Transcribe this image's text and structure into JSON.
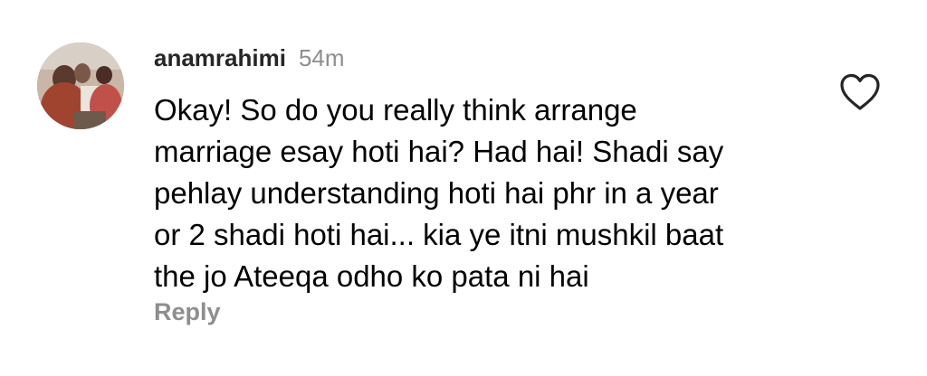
{
  "comment": {
    "username": "anamrahimi",
    "timestamp": "54m",
    "text_lines": [
      "Okay! So do you really think arrange",
      "marriage esay hoti hai? Had hai! Shadi say",
      "pehlay understanding hoti hai phr in a year",
      "or 2 shadi hoti hai... kia ye itni mushkil baat",
      "the jo Ateeqa odho ko pata ni hai"
    ],
    "reply_label": "Reply",
    "avatar_icon": "profile-photo",
    "like_icon": "heart-outline-icon"
  },
  "colors": {
    "username": "#262626",
    "secondary_text": "#8e8e8e",
    "body_text": "#000000",
    "heart_stroke": "#262626"
  }
}
